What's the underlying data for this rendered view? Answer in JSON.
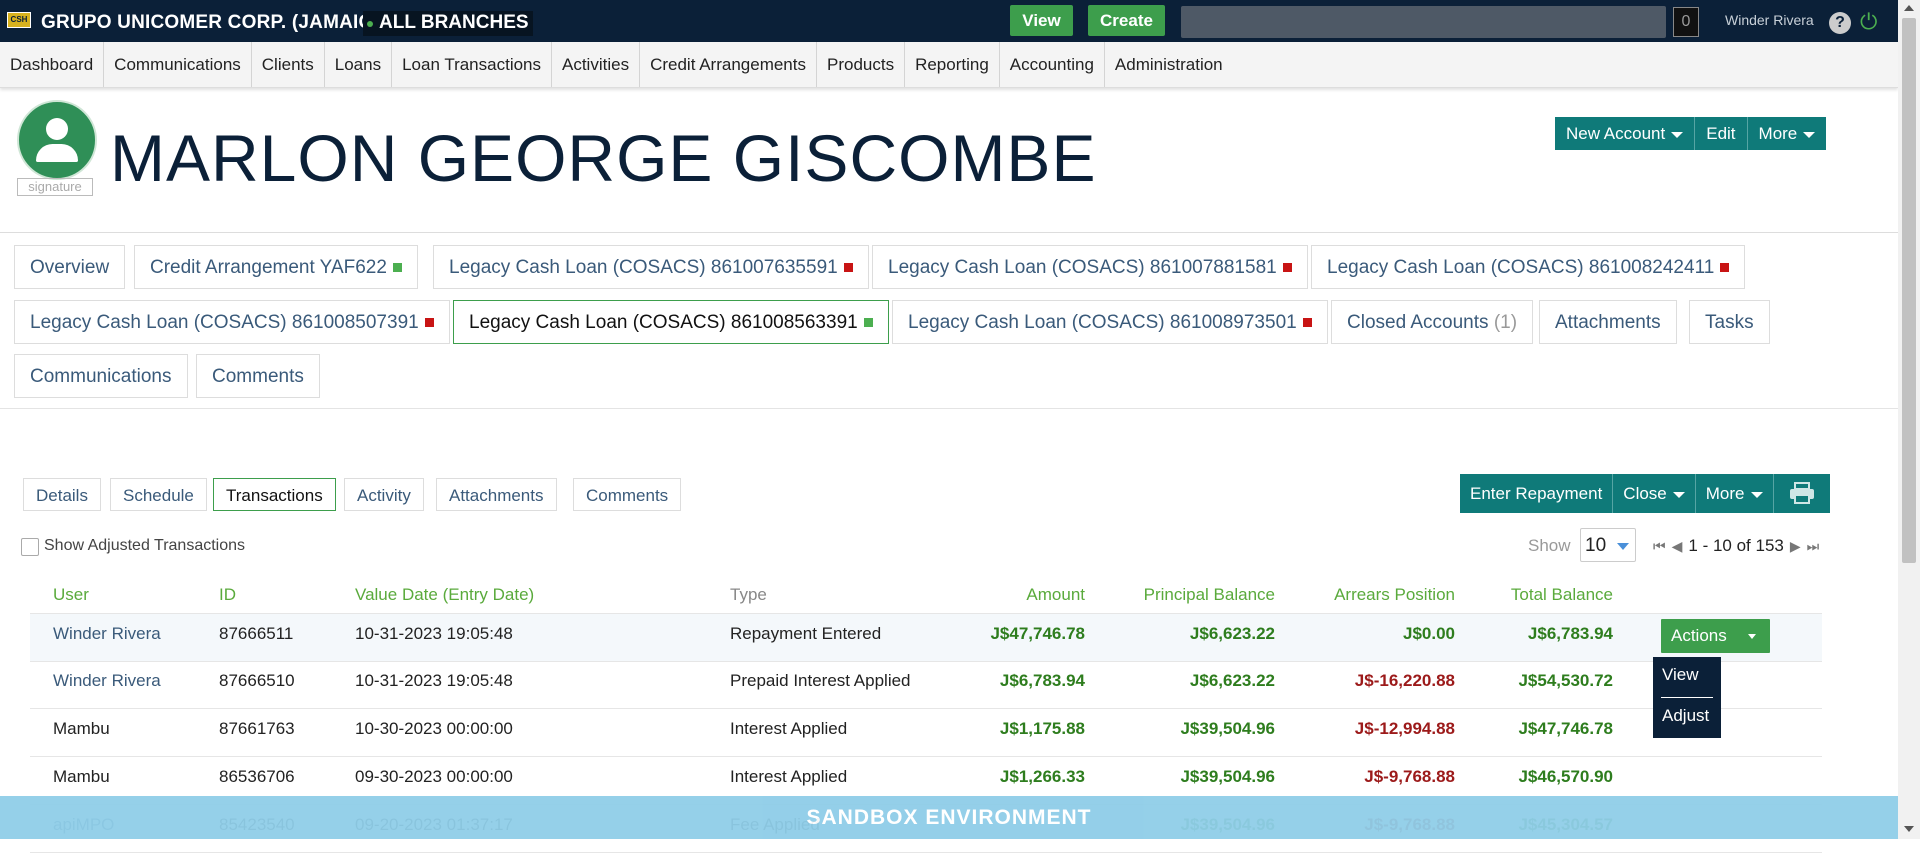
{
  "topbar": {
    "logo_text": "CSH",
    "company": "GRUPO UNICOMER CORP. (JAMAICA)",
    "branch": "ALL BRANCHES",
    "view_label": "View",
    "create_label": "Create",
    "search_value": "",
    "notification_count": "0",
    "username": "Winder Rivera",
    "help_glyph": "?",
    "power_glyph": "⏻"
  },
  "nav": [
    "Dashboard",
    "Communications",
    "Clients",
    "Loans",
    "Loan Transactions",
    "Activities",
    "Credit Arrangements",
    "Products",
    "Reporting",
    "Accounting",
    "Administration"
  ],
  "client": {
    "name": "MARLON GEORGE GISCOMBE",
    "signature_label": "signature",
    "actions": {
      "new_account": "New Account",
      "edit": "Edit",
      "more": "More"
    }
  },
  "account_tabs": [
    {
      "label": "Overview",
      "status": ""
    },
    {
      "label": "Credit Arrangement YAF622",
      "status": "green"
    },
    {
      "label": "Legacy Cash Loan (COSACS) 861007635591",
      "status": "red"
    },
    {
      "label": "Legacy Cash Loan (COSACS) 861007881581",
      "status": "red"
    },
    {
      "label": "Legacy Cash Loan (COSACS) 861008242411",
      "status": "red"
    },
    {
      "label": "Legacy Cash Loan (COSACS) 861008507391",
      "status": "red"
    },
    {
      "label": "Legacy Cash Loan (COSACS) 861008563391",
      "status": "green"
    },
    {
      "label": "Legacy Cash Loan (COSACS) 861008973501",
      "status": "red"
    },
    {
      "label": "Closed Accounts",
      "count": "(1)"
    },
    {
      "label": "Attachments"
    },
    {
      "label": "Tasks"
    },
    {
      "label": "Communications"
    },
    {
      "label": "Comments"
    }
  ],
  "sub_tabs": [
    "Details",
    "Schedule",
    "Transactions",
    "Activity",
    "Attachments",
    "Comments"
  ],
  "sub_actions": {
    "enter_repayment": "Enter Repayment",
    "close": "Close",
    "more": "More"
  },
  "controls": {
    "show_adjusted_label": "Show Adjusted Transactions",
    "show_label": "Show",
    "page_size": "10",
    "pager_text": "1 - 10 of 153"
  },
  "table": {
    "headers": [
      "User",
      "ID",
      "Value Date (Entry Date)",
      "Type",
      "Amount",
      "Principal Balance",
      "Arrears Position",
      "Total Balance"
    ],
    "rows": [
      [
        "Winder Rivera",
        "87666511",
        "10-31-2023 19:05:48",
        "Repayment Entered",
        "J$47,746.78",
        "J$6,623.22",
        "J$0.00",
        "J$6,783.94"
      ],
      [
        "Winder Rivera",
        "87666510",
        "10-31-2023 19:05:48",
        "Prepaid Interest Applied",
        "J$6,783.94",
        "J$6,623.22",
        "J$-16,220.88",
        "J$54,530.72"
      ],
      [
        "Mambu",
        "87661763",
        "10-30-2023 00:00:00",
        "Interest Applied",
        "J$1,175.88",
        "J$39,504.96",
        "J$-12,994.88",
        "J$47,746.78"
      ],
      [
        "Mambu",
        "86536706",
        "09-30-2023 00:00:00",
        "Interest Applied",
        "J$1,266.33",
        "J$39,504.96",
        "J$-9,768.88",
        "J$46,570.90"
      ],
      [
        "apiMPO",
        "85423540",
        "09-20-2023 01:37:17",
        "Fee Applied",
        "",
        "J$39,504.96",
        "J$-9,768.88",
        "J$45,304.57"
      ]
    ],
    "actions_label": "Actions",
    "menu": [
      "View",
      "Adjust"
    ]
  },
  "banner": "SANDBOX ENVIRONMENT",
  "colors": {
    "topbar": "#0b2038",
    "accent_green": "#3d9e4c",
    "teal": "#0f7a79",
    "negative": "#9c1a1a",
    "banner": "#8fcde8"
  }
}
